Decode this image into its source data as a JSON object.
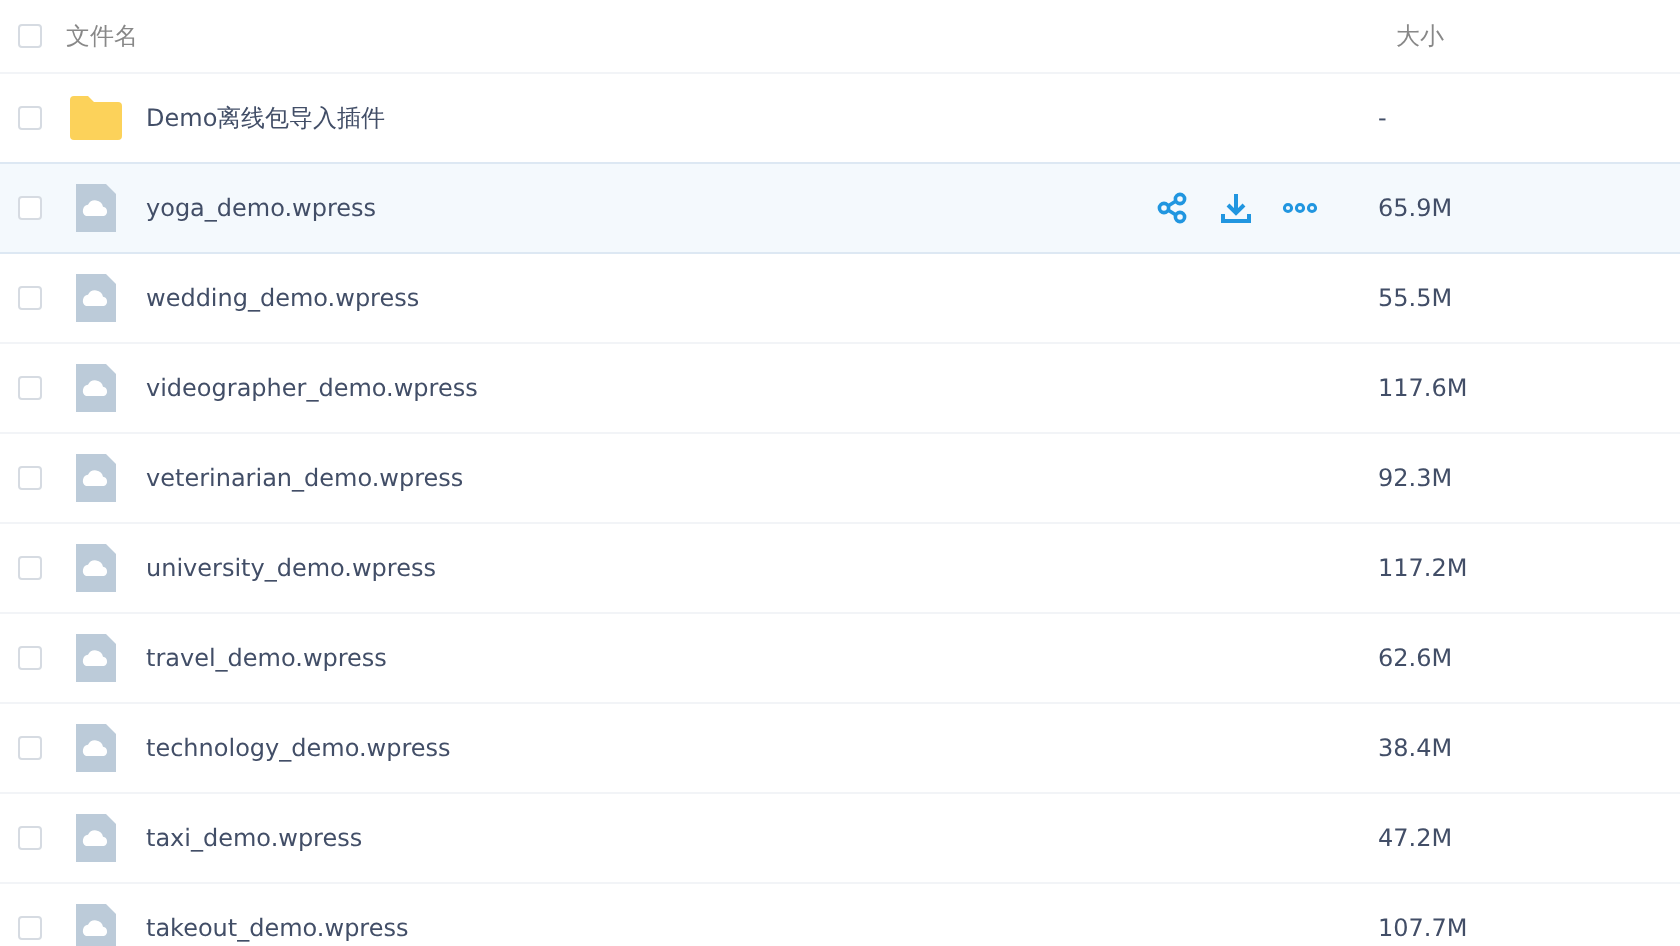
{
  "header": {
    "checked": false,
    "name_column": "文件名",
    "size_column": "大小"
  },
  "rows": [
    {
      "kind": "folder",
      "name": "Demo离线包导入插件",
      "size": "-",
      "checked": false,
      "hovered": false
    },
    {
      "kind": "file",
      "name": "yoga_demo.wpress",
      "size": "65.9M",
      "checked": false,
      "hovered": true
    },
    {
      "kind": "file",
      "name": "wedding_demo.wpress",
      "size": "55.5M",
      "checked": false,
      "hovered": false
    },
    {
      "kind": "file",
      "name": "videographer_demo.wpress",
      "size": "117.6M",
      "checked": false,
      "hovered": false
    },
    {
      "kind": "file",
      "name": "veterinarian_demo.wpress",
      "size": "92.3M",
      "checked": false,
      "hovered": false
    },
    {
      "kind": "file",
      "name": "university_demo.wpress",
      "size": "117.2M",
      "checked": false,
      "hovered": false
    },
    {
      "kind": "file",
      "name": "travel_demo.wpress",
      "size": "62.6M",
      "checked": false,
      "hovered": false
    },
    {
      "kind": "file",
      "name": "technology_demo.wpress",
      "size": "38.4M",
      "checked": false,
      "hovered": false
    },
    {
      "kind": "file",
      "name": "taxi_demo.wpress",
      "size": "47.2M",
      "checked": false,
      "hovered": false
    },
    {
      "kind": "file",
      "name": "takeout_demo.wpress",
      "size": "107.7M",
      "checked": false,
      "hovered": false
    }
  ]
}
